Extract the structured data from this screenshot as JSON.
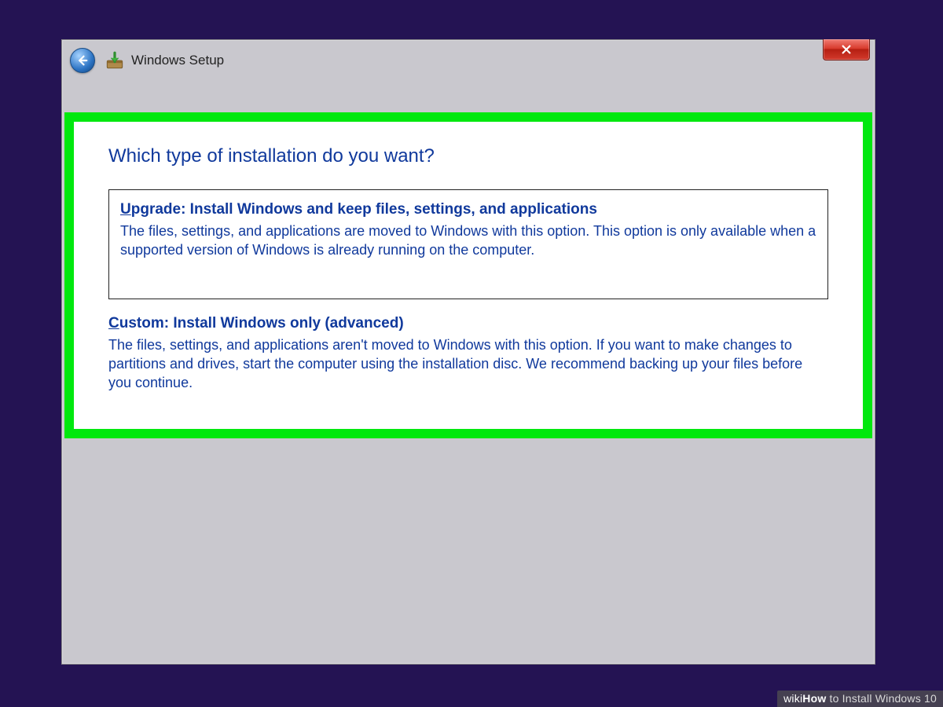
{
  "window": {
    "title": "Windows Setup"
  },
  "page": {
    "heading": "Which type of installation do you want?"
  },
  "options": {
    "upgrade": {
      "mnemonic": "U",
      "title_rest": "pgrade: Install Windows and keep files, settings, and applications",
      "description": "The files, settings, and applications are moved to Windows with this option. This option is only available when a supported version of Windows is already running on the computer."
    },
    "custom": {
      "mnemonic": "C",
      "title_rest": "ustom: Install Windows only (advanced)",
      "description": "The files, settings, and applications aren't moved to Windows with this option. If you want to make changes to partitions and drives, start the computer using the installation disc. We recommend backing up your files before you continue."
    }
  },
  "watermark": {
    "wiki": "wiki",
    "how": "How",
    "rest": " to Install Windows 10"
  }
}
